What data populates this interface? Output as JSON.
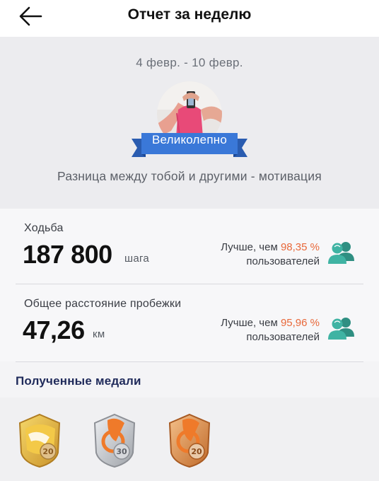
{
  "header": {
    "title": "Отчет за неделю",
    "back_icon": "arrow-left-icon"
  },
  "summary": {
    "date_range": "4 февр. - 10 февр.",
    "badge": "Великолепно",
    "motivation": "Разница между тобой и другими - мотивация"
  },
  "stats": [
    {
      "label": "Ходьба",
      "value": "187 800",
      "unit": "шага",
      "compare_prefix": "Лучше, чем",
      "percent": "98,35 %",
      "compare_suffix": "пользователей",
      "icon": "users-icon"
    },
    {
      "label": "Общее расстояние пробежки",
      "value": "47,26",
      "unit": "км",
      "compare_prefix": "Лучше, чем",
      "percent": "95,96 %",
      "compare_suffix": "пользователей",
      "icon": "users-icon"
    }
  ],
  "medals": {
    "title": "Полученные медали",
    "items": [
      {
        "name": "medal-steps-20",
        "label": "20",
        "color": "#e3b63a"
      },
      {
        "name": "medal-run-30",
        "label": "30",
        "color": "#b9bcc2"
      },
      {
        "name": "medal-run-20",
        "label": "20",
        "color": "#d98a3a"
      }
    ]
  },
  "colors": {
    "accent": "#e8683a",
    "ribbon": "#3a78d8",
    "icon_teal": "#3aa89a",
    "title_navy": "#1f2a5a"
  }
}
